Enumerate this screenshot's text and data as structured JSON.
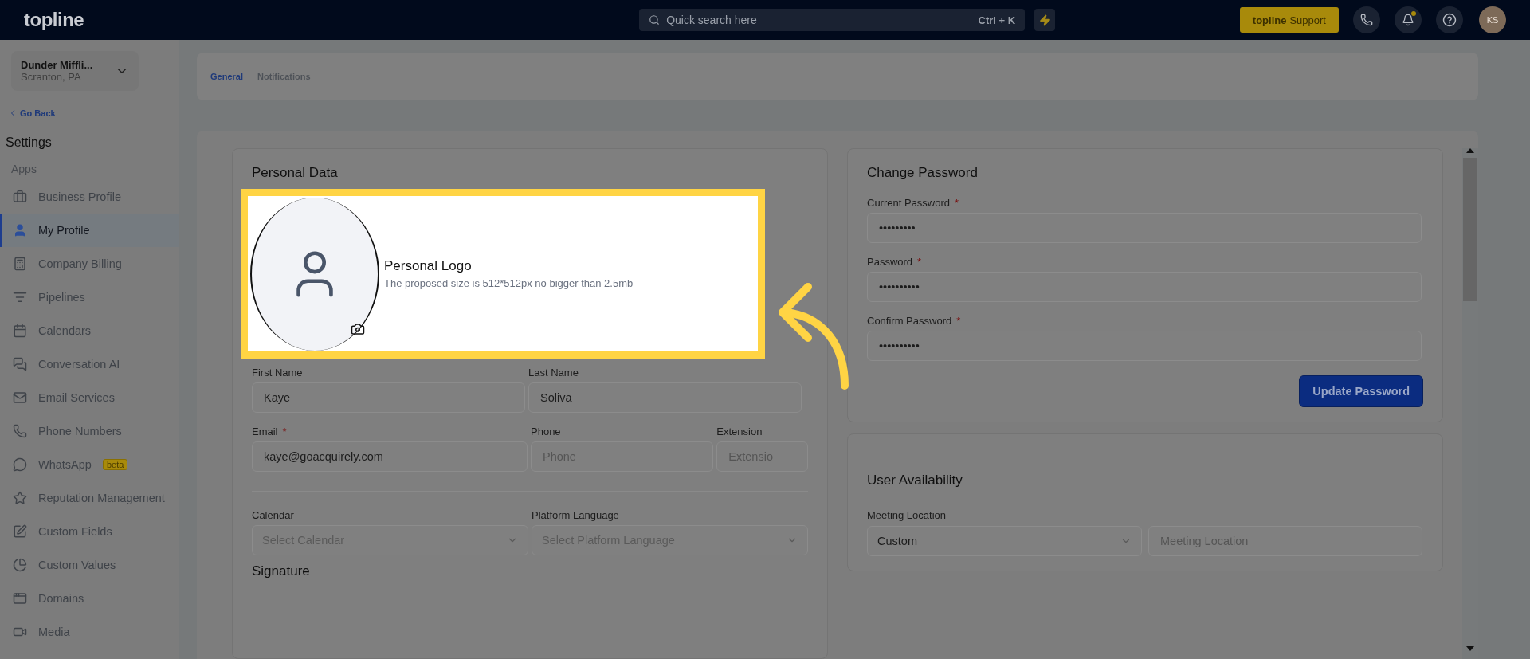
{
  "topbar": {
    "logo": "topline",
    "search": {
      "placeholder": "Quick search here",
      "shortcut": "Ctrl + K"
    },
    "support": {
      "brand": "topline",
      "label": "Support"
    },
    "notification_dot": true,
    "avatar": "KS"
  },
  "sidebar": {
    "account": {
      "name": "Dunder Miffli...",
      "location": "Scranton, PA"
    },
    "back": "Go Back",
    "title": "Settings",
    "section": "Apps",
    "items": [
      {
        "label": "Business Profile",
        "selected": false
      },
      {
        "label": "My Profile",
        "selected": true
      },
      {
        "label": "Company Billing",
        "selected": false
      },
      {
        "label": "Pipelines",
        "selected": false
      },
      {
        "label": "Calendars",
        "selected": false
      },
      {
        "label": "Conversation AI",
        "selected": false
      },
      {
        "label": "Email Services",
        "selected": false
      },
      {
        "label": "Phone Numbers",
        "selected": false
      },
      {
        "label": "WhatsApp",
        "selected": false,
        "badge": "beta"
      },
      {
        "label": "Reputation Management",
        "selected": false
      },
      {
        "label": "Custom Fields",
        "selected": false
      },
      {
        "label": "Custom Values",
        "selected": false
      },
      {
        "label": "Domains",
        "selected": false
      },
      {
        "label": "Media",
        "selected": false
      }
    ]
  },
  "tabs": [
    {
      "label": "General",
      "selected": true
    },
    {
      "label": "Notifications",
      "selected": false
    }
  ],
  "personal_data": {
    "title": "Personal Data",
    "logo": {
      "title": "Personal Logo",
      "hint": "The proposed size is 512*512px no bigger than 2.5mb"
    },
    "name_fields": [
      {
        "label": "First Name",
        "value": "Kaye"
      },
      {
        "label": "Last Name",
        "value": "Soliva"
      }
    ],
    "contact_fields": [
      {
        "label": "Email",
        "required_mark": "*",
        "value": "kaye@goacquirely.com"
      },
      {
        "label": "Phone",
        "placeholder": "Phone"
      },
      {
        "label": "Extension",
        "placeholder": "Extensio"
      }
    ],
    "selects": [
      {
        "label": "Calendar",
        "placeholder": "Select Calendar"
      },
      {
        "label": "Platform Language",
        "placeholder": "Select Platform Language"
      }
    ],
    "signature_title": "Signature"
  },
  "change_password": {
    "title": "Change Password",
    "fields": [
      {
        "label": "Current Password",
        "required_mark": "*",
        "value": "•••••••••"
      },
      {
        "label": "Password",
        "required_mark": "*",
        "value": "••••••••••"
      },
      {
        "label": "Confirm Password",
        "required_mark": "*",
        "value": "••••••••••"
      }
    ],
    "button": "Update Password"
  },
  "user_availability": {
    "title": "User Availability",
    "meeting_label": "Meeting Location",
    "meeting_type": "Custom",
    "meeting_placeholder": "Meeting Location"
  }
}
